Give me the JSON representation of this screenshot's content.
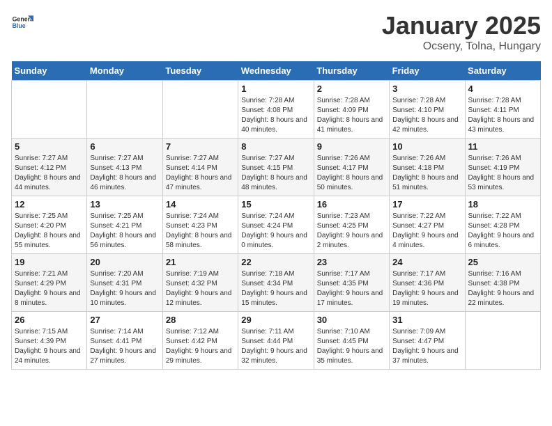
{
  "header": {
    "logo_general": "General",
    "logo_blue": "Blue",
    "title": "January 2025",
    "subtitle": "Ocseny, Tolna, Hungary"
  },
  "weekdays": [
    "Sunday",
    "Monday",
    "Tuesday",
    "Wednesday",
    "Thursday",
    "Friday",
    "Saturday"
  ],
  "weeks": [
    [
      {
        "day": "",
        "sunrise": "",
        "sunset": "",
        "daylight": ""
      },
      {
        "day": "",
        "sunrise": "",
        "sunset": "",
        "daylight": ""
      },
      {
        "day": "",
        "sunrise": "",
        "sunset": "",
        "daylight": ""
      },
      {
        "day": "1",
        "sunrise": "Sunrise: 7:28 AM",
        "sunset": "Sunset: 4:08 PM",
        "daylight": "Daylight: 8 hours and 40 minutes."
      },
      {
        "day": "2",
        "sunrise": "Sunrise: 7:28 AM",
        "sunset": "Sunset: 4:09 PM",
        "daylight": "Daylight: 8 hours and 41 minutes."
      },
      {
        "day": "3",
        "sunrise": "Sunrise: 7:28 AM",
        "sunset": "Sunset: 4:10 PM",
        "daylight": "Daylight: 8 hours and 42 minutes."
      },
      {
        "day": "4",
        "sunrise": "Sunrise: 7:28 AM",
        "sunset": "Sunset: 4:11 PM",
        "daylight": "Daylight: 8 hours and 43 minutes."
      }
    ],
    [
      {
        "day": "5",
        "sunrise": "Sunrise: 7:27 AM",
        "sunset": "Sunset: 4:12 PM",
        "daylight": "Daylight: 8 hours and 44 minutes."
      },
      {
        "day": "6",
        "sunrise": "Sunrise: 7:27 AM",
        "sunset": "Sunset: 4:13 PM",
        "daylight": "Daylight: 8 hours and 46 minutes."
      },
      {
        "day": "7",
        "sunrise": "Sunrise: 7:27 AM",
        "sunset": "Sunset: 4:14 PM",
        "daylight": "Daylight: 8 hours and 47 minutes."
      },
      {
        "day": "8",
        "sunrise": "Sunrise: 7:27 AM",
        "sunset": "Sunset: 4:15 PM",
        "daylight": "Daylight: 8 hours and 48 minutes."
      },
      {
        "day": "9",
        "sunrise": "Sunrise: 7:26 AM",
        "sunset": "Sunset: 4:17 PM",
        "daylight": "Daylight: 8 hours and 50 minutes."
      },
      {
        "day": "10",
        "sunrise": "Sunrise: 7:26 AM",
        "sunset": "Sunset: 4:18 PM",
        "daylight": "Daylight: 8 hours and 51 minutes."
      },
      {
        "day": "11",
        "sunrise": "Sunrise: 7:26 AM",
        "sunset": "Sunset: 4:19 PM",
        "daylight": "Daylight: 8 hours and 53 minutes."
      }
    ],
    [
      {
        "day": "12",
        "sunrise": "Sunrise: 7:25 AM",
        "sunset": "Sunset: 4:20 PM",
        "daylight": "Daylight: 8 hours and 55 minutes."
      },
      {
        "day": "13",
        "sunrise": "Sunrise: 7:25 AM",
        "sunset": "Sunset: 4:21 PM",
        "daylight": "Daylight: 8 hours and 56 minutes."
      },
      {
        "day": "14",
        "sunrise": "Sunrise: 7:24 AM",
        "sunset": "Sunset: 4:23 PM",
        "daylight": "Daylight: 8 hours and 58 minutes."
      },
      {
        "day": "15",
        "sunrise": "Sunrise: 7:24 AM",
        "sunset": "Sunset: 4:24 PM",
        "daylight": "Daylight: 9 hours and 0 minutes."
      },
      {
        "day": "16",
        "sunrise": "Sunrise: 7:23 AM",
        "sunset": "Sunset: 4:25 PM",
        "daylight": "Daylight: 9 hours and 2 minutes."
      },
      {
        "day": "17",
        "sunrise": "Sunrise: 7:22 AM",
        "sunset": "Sunset: 4:27 PM",
        "daylight": "Daylight: 9 hours and 4 minutes."
      },
      {
        "day": "18",
        "sunrise": "Sunrise: 7:22 AM",
        "sunset": "Sunset: 4:28 PM",
        "daylight": "Daylight: 9 hours and 6 minutes."
      }
    ],
    [
      {
        "day": "19",
        "sunrise": "Sunrise: 7:21 AM",
        "sunset": "Sunset: 4:29 PM",
        "daylight": "Daylight: 9 hours and 8 minutes."
      },
      {
        "day": "20",
        "sunrise": "Sunrise: 7:20 AM",
        "sunset": "Sunset: 4:31 PM",
        "daylight": "Daylight: 9 hours and 10 minutes."
      },
      {
        "day": "21",
        "sunrise": "Sunrise: 7:19 AM",
        "sunset": "Sunset: 4:32 PM",
        "daylight": "Daylight: 9 hours and 12 minutes."
      },
      {
        "day": "22",
        "sunrise": "Sunrise: 7:18 AM",
        "sunset": "Sunset: 4:34 PM",
        "daylight": "Daylight: 9 hours and 15 minutes."
      },
      {
        "day": "23",
        "sunrise": "Sunrise: 7:17 AM",
        "sunset": "Sunset: 4:35 PM",
        "daylight": "Daylight: 9 hours and 17 minutes."
      },
      {
        "day": "24",
        "sunrise": "Sunrise: 7:17 AM",
        "sunset": "Sunset: 4:36 PM",
        "daylight": "Daylight: 9 hours and 19 minutes."
      },
      {
        "day": "25",
        "sunrise": "Sunrise: 7:16 AM",
        "sunset": "Sunset: 4:38 PM",
        "daylight": "Daylight: 9 hours and 22 minutes."
      }
    ],
    [
      {
        "day": "26",
        "sunrise": "Sunrise: 7:15 AM",
        "sunset": "Sunset: 4:39 PM",
        "daylight": "Daylight: 9 hours and 24 minutes."
      },
      {
        "day": "27",
        "sunrise": "Sunrise: 7:14 AM",
        "sunset": "Sunset: 4:41 PM",
        "daylight": "Daylight: 9 hours and 27 minutes."
      },
      {
        "day": "28",
        "sunrise": "Sunrise: 7:12 AM",
        "sunset": "Sunset: 4:42 PM",
        "daylight": "Daylight: 9 hours and 29 minutes."
      },
      {
        "day": "29",
        "sunrise": "Sunrise: 7:11 AM",
        "sunset": "Sunset: 4:44 PM",
        "daylight": "Daylight: 9 hours and 32 minutes."
      },
      {
        "day": "30",
        "sunrise": "Sunrise: 7:10 AM",
        "sunset": "Sunset: 4:45 PM",
        "daylight": "Daylight: 9 hours and 35 minutes."
      },
      {
        "day": "31",
        "sunrise": "Sunrise: 7:09 AM",
        "sunset": "Sunset: 4:47 PM",
        "daylight": "Daylight: 9 hours and 37 minutes."
      },
      {
        "day": "",
        "sunrise": "",
        "sunset": "",
        "daylight": ""
      }
    ]
  ]
}
